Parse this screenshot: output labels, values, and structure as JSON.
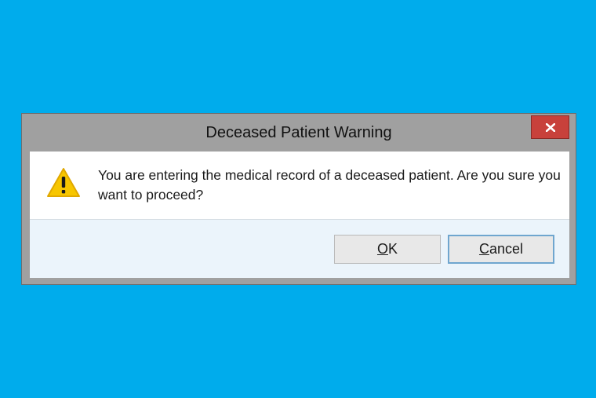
{
  "dialog": {
    "title": "Deceased Patient Warning",
    "message": "You are entering the medical record of a deceased patient. Are you sure you want to proceed?",
    "icon": "warning-icon",
    "close_icon": "close-icon",
    "buttons": {
      "ok": {
        "mnemonic": "O",
        "rest": "K"
      },
      "cancel": {
        "mnemonic": "C",
        "rest": "ancel"
      }
    }
  },
  "colors": {
    "desktop": "#00acec",
    "frame": "#a0a0a0",
    "close_button": "#c8413b",
    "warning": "#f7c600",
    "button_area": "#ebf4fb"
  }
}
